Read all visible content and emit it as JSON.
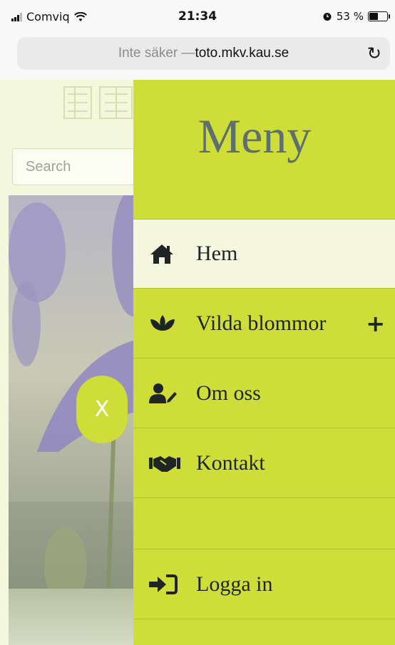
{
  "status_bar": {
    "carrier": "Comviq",
    "time": "21:34",
    "battery_percent": "53 %",
    "battery_level": 0.53
  },
  "url_bar": {
    "security_text": "Inte säker — ",
    "host": "toto.mkv.kau.se"
  },
  "page": {
    "search_placeholder": "Search"
  },
  "drawer": {
    "title": "Meny",
    "items": [
      {
        "label": "Hem",
        "icon": "home-icon",
        "active": true
      },
      {
        "label": "Vilda blommor",
        "icon": "lotus-icon",
        "expandable": true
      },
      {
        "label": "Om oss",
        "icon": "user-edit-icon"
      },
      {
        "label": "Kontakt",
        "icon": "handshake-icon"
      }
    ],
    "login_label": "Logga in",
    "expand_symbol": "+",
    "close_label": "X"
  },
  "colors": {
    "drawer_bg": "#cedd37",
    "active_item_bg": "#f5f8df",
    "title_color": "#5f6f6f"
  }
}
